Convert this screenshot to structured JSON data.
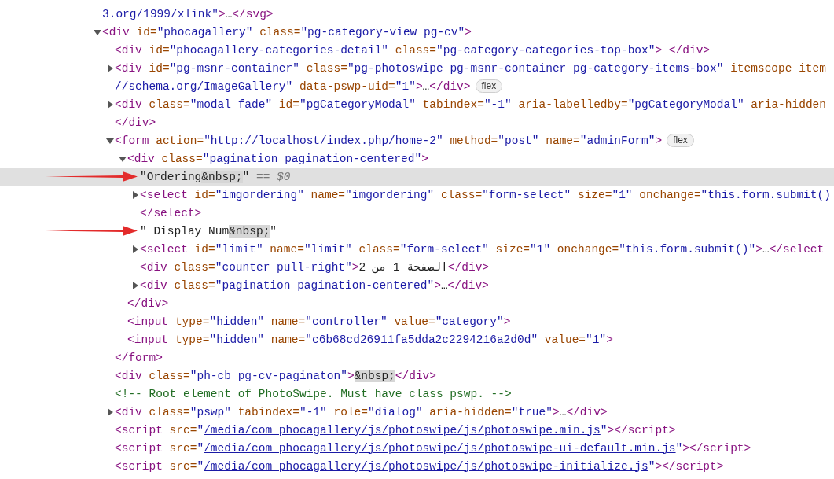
{
  "nodes": [
    {
      "selected": false,
      "lines": [
        [
          {
            "kind": "value",
            "text": "3.org/1999/xlink\""
          },
          {
            "kind": "tag",
            "text": ">"
          },
          {
            "kind": "text",
            "text": "…"
          },
          {
            "kind": "tag",
            "text": "</svg>"
          }
        ]
      ]
    },
    {
      "selected": false,
      "expanded": true,
      "lines": [
        [
          {
            "kind": "tag",
            "text": "<div"
          },
          {
            "kind": "attr",
            "text": " id=",
            "value": "\"phocagallery\""
          },
          {
            "kind": "attr",
            "text": " class=",
            "value": "\"pg-category-view pg-cv\""
          },
          {
            "kind": "tag",
            "text": ">"
          }
        ]
      ],
      "children": [
        {
          "selected": false,
          "lines": [
            [
              {
                "kind": "tag",
                "text": "<div"
              },
              {
                "kind": "attr",
                "text": " id=",
                "value": "\"phocagallery-categories-detail\""
              },
              {
                "kind": "attr",
                "text": " class=",
                "value": "\"pg-category-categories-top-box\""
              },
              {
                "kind": "tag",
                "text": "> </div>"
              }
            ]
          ]
        },
        {
          "selected": false,
          "expanded": false,
          "badge": "flex",
          "lines": [
            [
              {
                "kind": "tag",
                "text": "<div"
              },
              {
                "kind": "attr",
                "text": " id=",
                "value": "\"pg-msnr-container\""
              },
              {
                "kind": "attr",
                "text": " class=",
                "value": "\"pg-photoswipe pg-msnr-container pg-category-items-box\""
              },
              {
                "kind": "attr",
                "text": " itemscope item"
              }
            ],
            [
              {
                "kind": "value",
                "text": "//schema.org/ImageGallery\""
              },
              {
                "kind": "attr",
                "text": " data-pswp-uid=",
                "value": "\"1\""
              },
              {
                "kind": "tag",
                "text": ">"
              },
              {
                "kind": "text",
                "text": "…"
              },
              {
                "kind": "tag",
                "text": "</div>"
              }
            ]
          ]
        },
        {
          "selected": false,
          "expanded": false,
          "lines": [
            [
              {
                "kind": "tag",
                "text": "<div"
              },
              {
                "kind": "attr",
                "text": " class=",
                "value": "\"modal fade\""
              },
              {
                "kind": "attr",
                "text": " id=",
                "value": "\"pgCategoryModal\""
              },
              {
                "kind": "attr",
                "text": " tabindex=",
                "value": "\"-1\""
              },
              {
                "kind": "attr",
                "text": " aria-labelledby=",
                "value": "\"pgCategoryModal\""
              },
              {
                "kind": "attr",
                "text": " aria-hidden"
              }
            ],
            [
              {
                "kind": "tag",
                "text": "</div>"
              }
            ]
          ]
        },
        {
          "selected": false,
          "expanded": true,
          "badge": "flex",
          "lines": [
            [
              {
                "kind": "tag",
                "text": "<form"
              },
              {
                "kind": "attr",
                "text": " action=",
                "value": "\"http://localhost/index.php/home-2\""
              },
              {
                "kind": "attr",
                "text": " method=",
                "value": "\"post\""
              },
              {
                "kind": "attr",
                "text": " name=",
                "value": "\"adminForm\""
              },
              {
                "kind": "tag",
                "text": ">"
              }
            ]
          ],
          "closing": [
            {
              "kind": "tag",
              "text": "</form>"
            }
          ],
          "children": [
            {
              "selected": false,
              "expanded": true,
              "lines": [
                [
                  {
                    "kind": "tag",
                    "text": "<div"
                  },
                  {
                    "kind": "attr",
                    "text": " class=",
                    "value": "\"pagination pagination-centered\""
                  },
                  {
                    "kind": "tag",
                    "text": ">"
                  }
                ]
              ],
              "closing": [
                {
                  "kind": "tag",
                  "text": "</div>"
                }
              ],
              "children": [
                {
                  "selected": true,
                  "arrow": true,
                  "lines": [
                    [
                      {
                        "kind": "text",
                        "text": "\"Ordering"
                      },
                      {
                        "kind": "entity",
                        "text": "&nbsp;"
                      },
                      {
                        "kind": "text",
                        "text": "\""
                      },
                      {
                        "kind": "hint",
                        "text": " == $0"
                      }
                    ]
                  ]
                },
                {
                  "selected": false,
                  "expanded": false,
                  "lines": [
                    [
                      {
                        "kind": "tag",
                        "text": "<select"
                      },
                      {
                        "kind": "attr",
                        "text": " id=",
                        "value": "\"imgordering\""
                      },
                      {
                        "kind": "attr",
                        "text": " name=",
                        "value": "\"imgordering\""
                      },
                      {
                        "kind": "attr",
                        "text": " class=",
                        "value": "\"form-select\""
                      },
                      {
                        "kind": "attr",
                        "text": " size=",
                        "value": "\"1\""
                      },
                      {
                        "kind": "attr",
                        "text": " onchange=",
                        "value": "\"this.form.submit()"
                      }
                    ],
                    [
                      {
                        "kind": "tag",
                        "text": "</select>"
                      }
                    ]
                  ]
                },
                {
                  "selected": false,
                  "arrow": true,
                  "lines": [
                    [
                      {
                        "kind": "text",
                        "text": "\" Display Num"
                      },
                      {
                        "kind": "entity",
                        "text": "&nbsp;"
                      },
                      {
                        "kind": "text",
                        "text": "\""
                      }
                    ]
                  ]
                },
                {
                  "selected": false,
                  "expanded": false,
                  "lines": [
                    [
                      {
                        "kind": "tag",
                        "text": "<select"
                      },
                      {
                        "kind": "attr",
                        "text": " id=",
                        "value": "\"limit\""
                      },
                      {
                        "kind": "attr",
                        "text": " name=",
                        "value": "\"limit\""
                      },
                      {
                        "kind": "attr",
                        "text": " class=",
                        "value": "\"form-select\""
                      },
                      {
                        "kind": "attr",
                        "text": " size=",
                        "value": "\"1\""
                      },
                      {
                        "kind": "attr",
                        "text": " onchange=",
                        "value": "\"this.form.submit()\""
                      },
                      {
                        "kind": "tag",
                        "text": ">"
                      },
                      {
                        "kind": "text",
                        "text": "…"
                      },
                      {
                        "kind": "tag",
                        "text": "</select"
                      }
                    ]
                  ]
                },
                {
                  "selected": false,
                  "lines": [
                    [
                      {
                        "kind": "tag",
                        "text": "<div"
                      },
                      {
                        "kind": "attr",
                        "text": " class=",
                        "value": "\"counter pull-right\""
                      },
                      {
                        "kind": "tag",
                        "text": ">"
                      },
                      {
                        "kind": "text",
                        "text": "الصفحة 1 من 2"
                      },
                      {
                        "kind": "tag",
                        "text": "</div>"
                      }
                    ]
                  ]
                },
                {
                  "selected": false,
                  "expanded": false,
                  "lines": [
                    [
                      {
                        "kind": "tag",
                        "text": "<div"
                      },
                      {
                        "kind": "attr",
                        "text": " class=",
                        "value": "\"pagination pagination-centered\""
                      },
                      {
                        "kind": "tag",
                        "text": ">"
                      },
                      {
                        "kind": "text",
                        "text": "…"
                      },
                      {
                        "kind": "tag",
                        "text": "</div>"
                      }
                    ]
                  ]
                }
              ]
            },
            {
              "selected": false,
              "lines": [
                [
                  {
                    "kind": "tag",
                    "text": "<input"
                  },
                  {
                    "kind": "attr",
                    "text": " type=",
                    "value": "\"hidden\""
                  },
                  {
                    "kind": "attr",
                    "text": " name=",
                    "value": "\"controller\""
                  },
                  {
                    "kind": "attr",
                    "text": " value=",
                    "value": "\"category\""
                  },
                  {
                    "kind": "tag",
                    "text": ">"
                  }
                ]
              ]
            },
            {
              "selected": false,
              "lines": [
                [
                  {
                    "kind": "tag",
                    "text": "<input"
                  },
                  {
                    "kind": "attr",
                    "text": " type=",
                    "value": "\"hidden\""
                  },
                  {
                    "kind": "attr",
                    "text": " name=",
                    "value": "\"c6b68cd26911fa5dda2c2294216a2d0d\""
                  },
                  {
                    "kind": "attr",
                    "text": " value=",
                    "value": "\"1\""
                  },
                  {
                    "kind": "tag",
                    "text": ">"
                  }
                ]
              ]
            }
          ]
        },
        {
          "selected": false,
          "lines": [
            [
              {
                "kind": "tag",
                "text": "<div"
              },
              {
                "kind": "attr",
                "text": " class=",
                "value": "\"ph-cb pg-cv-paginaton\""
              },
              {
                "kind": "tag",
                "text": ">"
              },
              {
                "kind": "entity",
                "text": "&nbsp;"
              },
              {
                "kind": "tag",
                "text": "</div>"
              }
            ]
          ]
        },
        {
          "selected": false,
          "lines": [
            [
              {
                "kind": "comment",
                "text": "<!-- Root element of PhotoSwipe. Must have class pswp. -->"
              }
            ]
          ]
        },
        {
          "selected": false,
          "expanded": false,
          "lines": [
            [
              {
                "kind": "tag",
                "text": "<div"
              },
              {
                "kind": "attr",
                "text": " class=",
                "value": "\"pswp\""
              },
              {
                "kind": "attr",
                "text": " tabindex=",
                "value": "\"-1\""
              },
              {
                "kind": "attr",
                "text": " role=",
                "value": "\"dialog\""
              },
              {
                "kind": "attr",
                "text": " aria-hidden=",
                "value": "\"true\""
              },
              {
                "kind": "tag",
                "text": ">"
              },
              {
                "kind": "text",
                "text": "…"
              },
              {
                "kind": "tag",
                "text": "</div>"
              }
            ]
          ]
        },
        {
          "selected": false,
          "lines": [
            [
              {
                "kind": "tag",
                "text": "<script"
              },
              {
                "kind": "attr",
                "text": " src=",
                "value": "\""
              },
              {
                "kind": "link",
                "text": "/media/com_phocagallery/js/photoswipe/js/photoswipe.min.js"
              },
              {
                "kind": "value",
                "text": "\""
              },
              {
                "kind": "tag",
                "text": "></script>"
              }
            ]
          ]
        },
        {
          "selected": false,
          "lines": [
            [
              {
                "kind": "tag",
                "text": "<script"
              },
              {
                "kind": "attr",
                "text": " src=",
                "value": "\""
              },
              {
                "kind": "link",
                "text": "/media/com_phocagallery/js/photoswipe/js/photoswipe-ui-default.min.js"
              },
              {
                "kind": "value",
                "text": "\""
              },
              {
                "kind": "tag",
                "text": "></script>"
              }
            ]
          ]
        },
        {
          "selected": false,
          "lines": [
            [
              {
                "kind": "tag",
                "text": "<script"
              },
              {
                "kind": "attr",
                "text": " src=",
                "value": "\""
              },
              {
                "kind": "link",
                "text": "/media/com_phocagallery/js/photoswipe/js/photoswipe-initialize.js"
              },
              {
                "kind": "value",
                "text": "\""
              },
              {
                "kind": "tag",
                "text": "></script>"
              }
            ]
          ]
        }
      ]
    }
  ]
}
